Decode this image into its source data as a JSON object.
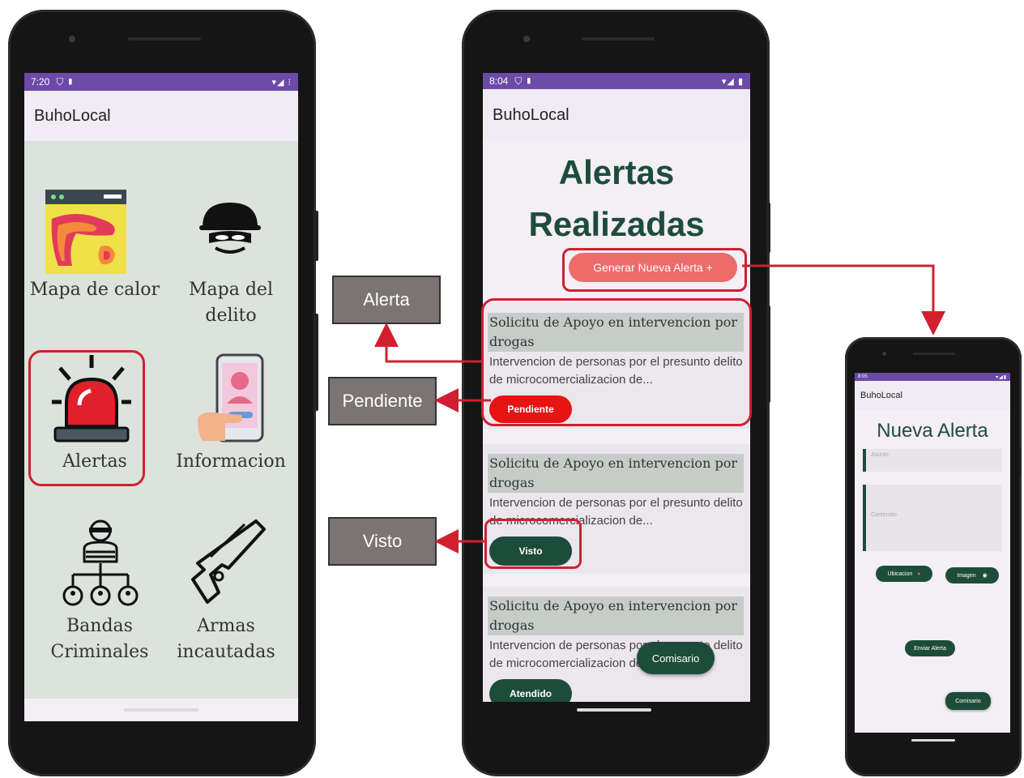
{
  "colors": {
    "status_bar": "#6b4aa8",
    "brand_green": "#1d4d3a",
    "pending_red": "#e71414",
    "generate_button": "#ec6b6b",
    "highlight_red": "#d02030"
  },
  "phone_home": {
    "status_time": "7:20",
    "status_icons": "▾◢ ⁝",
    "app_title": "BuhoLocal",
    "tiles": [
      {
        "label": "Mapa de calor",
        "icon": "heatmap-icon"
      },
      {
        "label": "Mapa del delito",
        "icon": "thief-icon"
      },
      {
        "label": "Alertas",
        "icon": "siren-icon"
      },
      {
        "label": "Informacion",
        "icon": "phone-profile-icon"
      },
      {
        "label": "Bandas Criminales",
        "icon": "criminal-network-icon"
      },
      {
        "label": "Armas incautadas",
        "icon": "gun-icon"
      }
    ]
  },
  "phone_alerts": {
    "status_time": "8:04",
    "status_icons": "▾◢ ▮",
    "app_title": "BuhoLocal",
    "page_title_line1": "Alertas",
    "page_title_line2": "Realizadas",
    "generate_button": "Generar Nueva Alerta  +",
    "alerts": [
      {
        "title": "Solicitu de Apoyo en intervencion por drogas",
        "description": "Intervencion de personas por el presunto delito de microcomercializacion de...",
        "status": "Pendiente"
      },
      {
        "title": "Solicitu de Apoyo en intervencion por drogas",
        "description": "Intervencion de personas por el presunto delito de microcomercializacion de...",
        "status": "Visto"
      },
      {
        "title": "Solicitu de Apoyo en intervencion por drogas",
        "description": "Intervencion de personas por el presunto delito de microcomercializacion de...",
        "status": "Atendido"
      }
    ],
    "fab_label": "Comisario"
  },
  "annotations": {
    "alerta": "Alerta",
    "pendiente": "Pendiente",
    "visto": "Visto"
  },
  "phone_new": {
    "status_time": "8:05",
    "app_title": "BuhoLocal",
    "page_title": "Nueva Alerta",
    "subject_placeholder": "Asunto",
    "content_placeholder": "Contenido",
    "location_button": "Ubicacion",
    "image_button": "Imagen",
    "send_button": "Enviar Alerta",
    "fab_label": "Comisario"
  }
}
